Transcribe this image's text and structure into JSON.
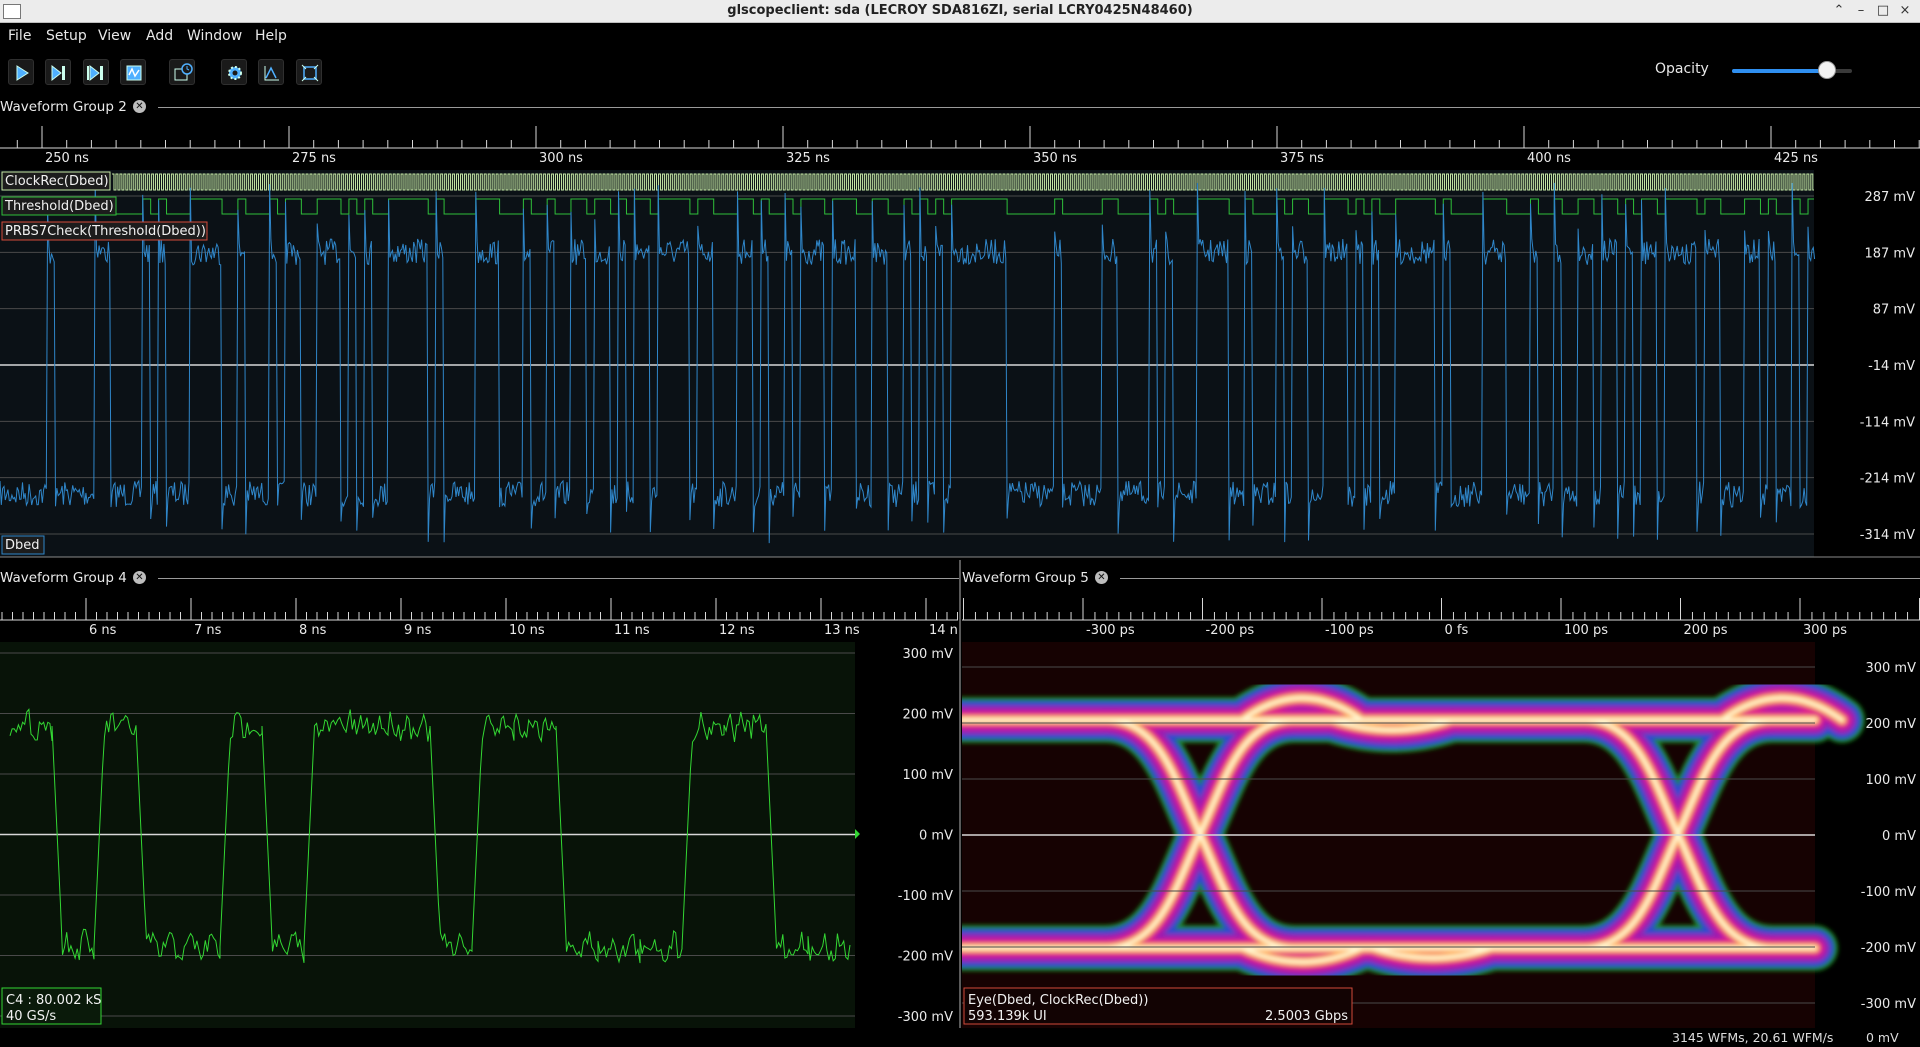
{
  "window": {
    "title": "glscopeclient: sda (LECROY SDA816ZI, serial LCRY0425N48460)",
    "controls": [
      "⌃",
      "–",
      "□",
      "×"
    ]
  },
  "menu": [
    "File",
    "Setup",
    "View",
    "Add",
    "Window",
    "Help"
  ],
  "toolbar": {
    "buttons": [
      "start-trigger",
      "single-trigger",
      "force-trigger",
      "stop-trigger",
      "history",
      "settings",
      "fit-to-screen",
      "fullscreen"
    ],
    "opacity_label": "Opacity",
    "opacity_value": 0.79
  },
  "groups": [
    {
      "title": "Waveform Group 2",
      "timeline_ticks": [
        "250 ns",
        "275 ns",
        "300 ns",
        "325 ns",
        "350 ns",
        "375 ns",
        "400 ns",
        "425 ns"
      ],
      "y_labels": [
        "287 mV",
        "187 mV",
        "87 mV",
        "-14 mV",
        "-114 mV",
        "-214 mV",
        "-314 mV"
      ],
      "digital_traces": [
        {
          "label": "ClockRec(Dbed)",
          "color": "#c6e9a6"
        },
        {
          "label": "Threshold(Dbed)",
          "color": "#2fbf3a"
        }
      ],
      "protocol_label": "PRBS7Check(Threshold(Dbed))",
      "analog_label": "Dbed",
      "trace_color": "#2f86c9"
    },
    {
      "title": "Waveform Group 4",
      "timeline_ticks": [
        "6 ns",
        "7 ns",
        "8 ns",
        "9 ns",
        "10 ns",
        "11 ns",
        "12 ns",
        "13 ns",
        "14 n"
      ],
      "y_labels": [
        "300 mV",
        "200 mV",
        "100 mV",
        "0 mV",
        "-100 mV",
        "-200 mV",
        "-300 mV"
      ],
      "info_line1": "C4 : 80.002 kS",
      "info_line2": "40 GS/s",
      "trace_color": "#33d633"
    },
    {
      "title": "Waveform Group 5",
      "timeline_ticks": [
        "-300 ps",
        "-200 ps",
        "-100 ps",
        "0 fs",
        "100 ps",
        "200 ps",
        "300 ps"
      ],
      "y_labels": [
        "300 mV",
        "200 mV",
        "100 mV",
        "0 mV",
        "-100 mV",
        "-200 mV",
        "-300 mV"
      ],
      "info_line1": "Eye(Dbed, ClockRec(Dbed))",
      "info_line2": "593.139k UI",
      "info_rate": "2.5003 Gbps"
    }
  ],
  "status": {
    "wfms": "3145 WFMs, 20.61 WFM/s",
    "readout": "0 mV"
  }
}
